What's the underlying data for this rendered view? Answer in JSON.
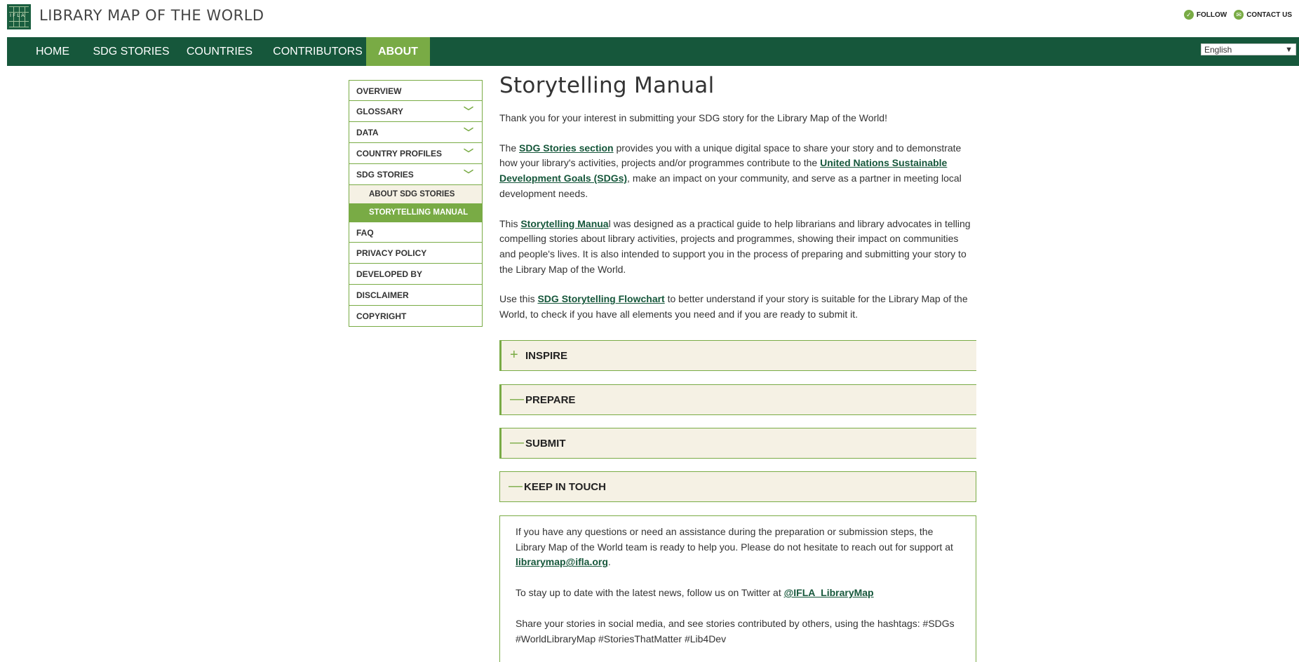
{
  "header": {
    "site_title": "LIBRARY MAP OF THE WORLD",
    "logo_text": "IFLA",
    "follow_label": "FOLLOW",
    "contact_label": "CONTACT US"
  },
  "nav": {
    "items": [
      {
        "label": "HOME"
      },
      {
        "label": "SDG STORIES"
      },
      {
        "label": "COUNTRIES"
      },
      {
        "label": "CONTRIBUTORS"
      },
      {
        "label": "ABOUT"
      }
    ],
    "active": "ABOUT",
    "language": "English"
  },
  "sidebar": {
    "items": [
      {
        "label": "OVERVIEW"
      },
      {
        "label": "GLOSSARY"
      },
      {
        "label": "DATA"
      },
      {
        "label": "COUNTRY PROFILES"
      },
      {
        "label": "SDG STORIES"
      },
      {
        "label": "ABOUT SDG STORIES"
      },
      {
        "label": "STORYTELLING MANUAL"
      },
      {
        "label": "FAQ"
      },
      {
        "label": "PRIVACY POLICY"
      },
      {
        "label": "DEVELOPED BY"
      },
      {
        "label": "DISCLAIMER"
      },
      {
        "label": "COPYRIGHT"
      }
    ],
    "active": "STORYTELLING MANUAL"
  },
  "main": {
    "title": "Storytelling Manual",
    "intro": "Thank you for your interest in submitting your SDG story for the Library Map of the World!",
    "p2": {
      "a": "The ",
      "link1": "SDG Stories section",
      "b": " provides you with a unique digital space to share your story and to demonstrate how your library's activities, projects and/or programmes contribute to the ",
      "link2": "United Nations Sustainable Development Goals (SDGs)",
      "c": ", make an impact on your community, and serve as a partner in meeting local development needs."
    },
    "p3": {
      "a": "This ",
      "link": "Storytelling Manua",
      "b": "l was designed as a practical guide to help librarians and library advocates in telling compelling stories about library activities, projects and programmes, showing their impact on communities and people's lives. It is also intended to support you in the process of preparing and submitting your story to the Library Map of the World."
    },
    "p4": {
      "a": "Use this ",
      "link": "SDG Storytelling Flowchart",
      "b": " to better understand if your story is suitable for the Library Map of the World, to check if you have all elements you need and if you are ready to submit it."
    },
    "accordions": [
      {
        "label": "INSPIRE",
        "sign": "+"
      },
      {
        "label": "PREPARE",
        "sign": "—"
      },
      {
        "label": "SUBMIT",
        "sign": "—"
      },
      {
        "label": "KEEP IN TOUCH",
        "sign": "—"
      }
    ],
    "keep_in_touch": {
      "p1a": "If you have any questions or need an assistance during the preparation or submission steps, the Library Map of the World team is ready to help you. Please do not hesitate to reach out for support at ",
      "email": "librarymap@ifla.org",
      "p1b": ".",
      "p2a": "To stay up to date with the latest news, follow us on Twitter at ",
      "twitter": "@IFLA_LibraryMap",
      "p3": "Share your stories in social media, and see stories contributed by others, using the hashtags: #SDGs #WorldLibraryMap #StoriesThatMatter #Lib4Dev"
    }
  },
  "colors": {
    "dark_green": "#16573b",
    "light_green": "#79ab45",
    "cream": "#f5f1e4"
  }
}
